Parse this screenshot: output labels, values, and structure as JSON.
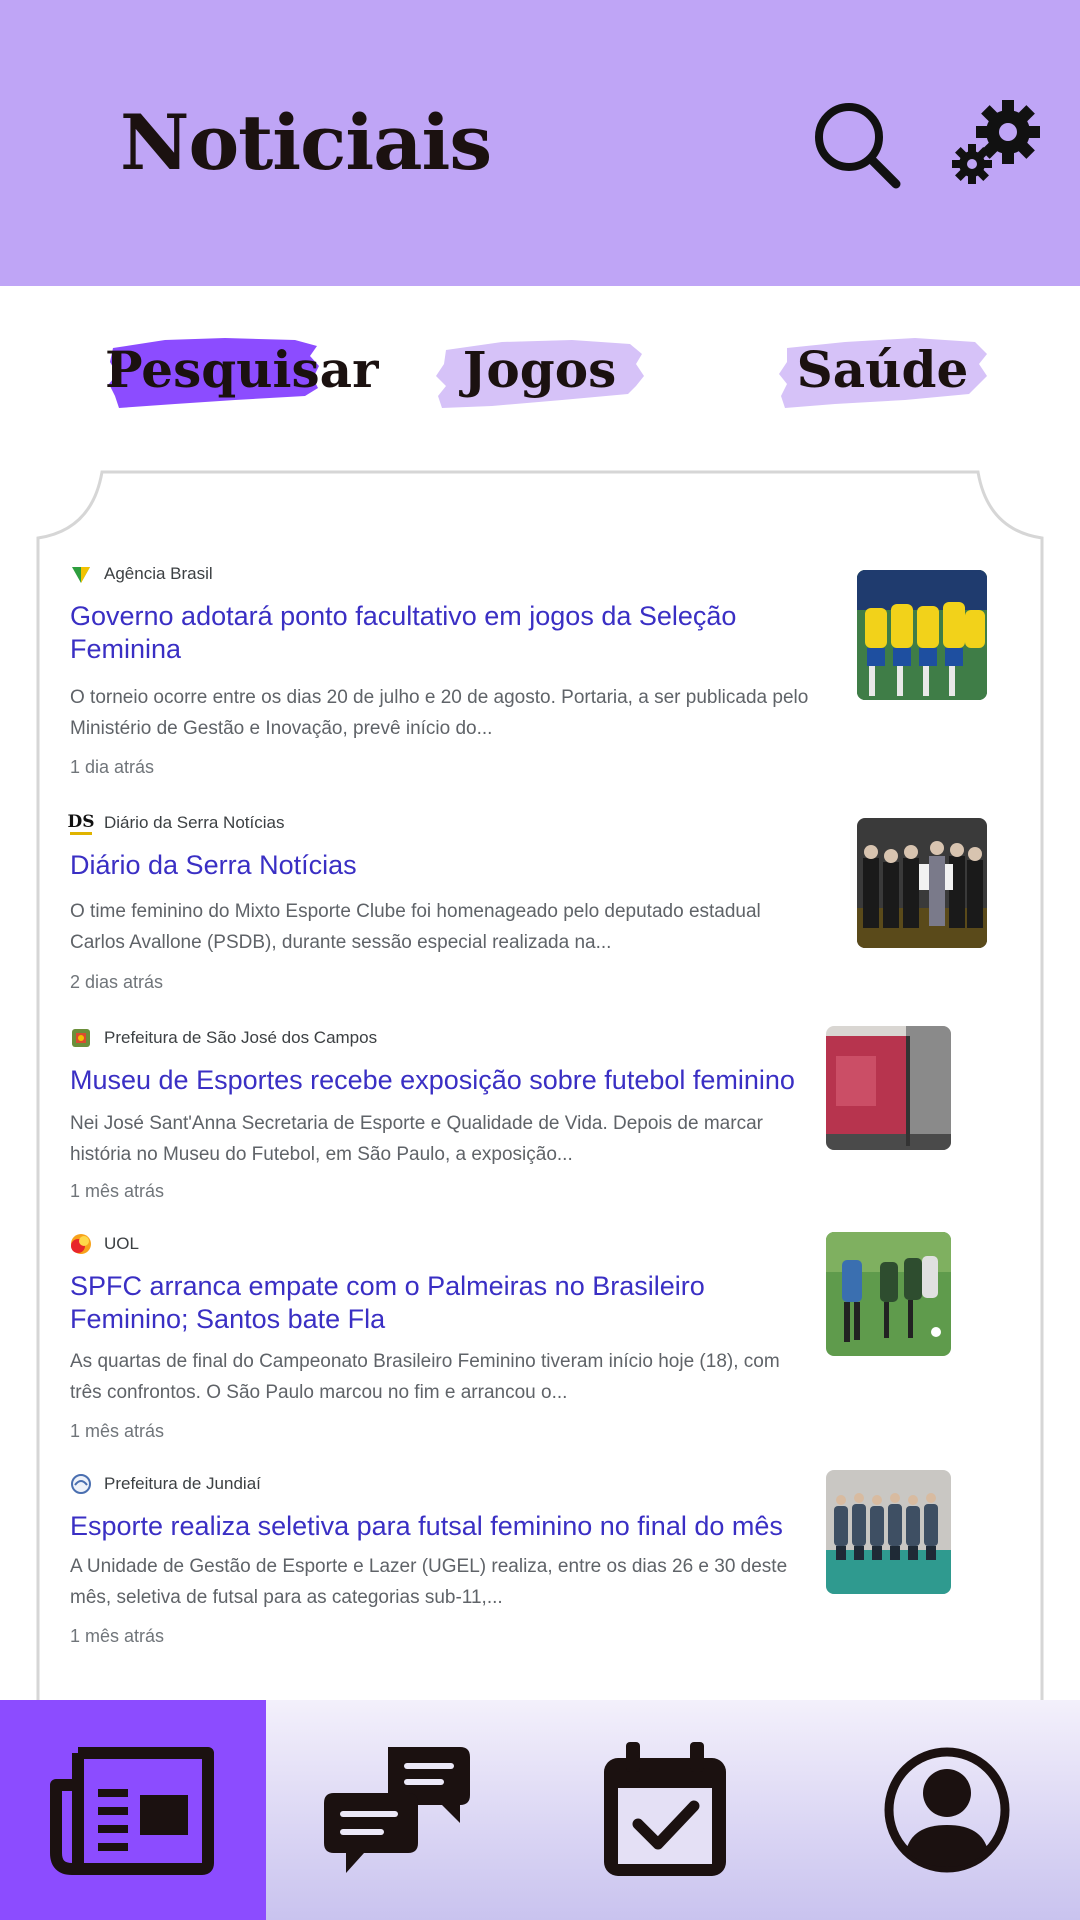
{
  "app": {
    "title": "Noticiais"
  },
  "header": {
    "search_icon": "search-icon",
    "settings_icon": "gears-icon"
  },
  "tabs": [
    {
      "label": "Pesquisar",
      "active": true,
      "color": "#8c4cff"
    },
    {
      "label": "Jogos",
      "active": false,
      "color": "#d6c2f8"
    },
    {
      "label": "Saúde",
      "active": false,
      "color": "#d6c2f8"
    }
  ],
  "news": [
    {
      "source": "Agência Brasil",
      "headline_line1": "Governo adotará ponto facultativo em jogos da Seleção",
      "headline_line2": "Feminina",
      "snippet_line1": "O torneio ocorre entre os dias 20 de julho e 20 de agosto. Portaria, a ser publicada pelo",
      "snippet_line2": "Ministério de Gestão e Inovação, prevê início do...",
      "time": "1 dia atrás"
    },
    {
      "source": "Diário da Serra Notícias",
      "headline_line1": "Diário da Serra Notícias",
      "snippet_line1": "O time feminino do Mixto Esporte Clube foi homenageado pelo deputado estadual",
      "snippet_line2": "Carlos Avallone (PSDB), durante sessão especial realizada na...",
      "time": "2 dias atrás"
    },
    {
      "source": "Prefeitura de São José dos Campos",
      "headline_line1": "Museu de Esportes recebe exposição sobre futebol feminino",
      "snippet_line1": "Nei José Sant'Anna Secretaria de Esporte e Qualidade de Vida. Depois de marcar",
      "snippet_line2": "história no Museu do Futebol, em São Paulo, a exposição...",
      "time": "1 mês atrás"
    },
    {
      "source": "UOL",
      "headline_line1": "SPFC arranca empate com o Palmeiras no Brasileiro",
      "headline_line2": "Feminino; Santos bate Fla",
      "snippet_line1": "As quartas de final do Campeonato Brasileiro Feminino tiveram início hoje (18), com",
      "snippet_line2": "três confrontos. O São Paulo marcou no fim e arrancou o...",
      "time": "1 mês atrás"
    },
    {
      "source": "Prefeitura de Jundiaí",
      "headline_line1": "Esporte realiza seletiva para futsal feminino no final do mês",
      "snippet_line1": "A Unidade de Gestão de Esporte e Lazer (UGEL) realiza, entre os dias 26 e 30 deste",
      "snippet_line2": "mês, seletiva de futsal para as categorias sub-11,...",
      "time": "1 mês atrás"
    }
  ],
  "source_logo_text": {
    "ds": "DS"
  },
  "nav": [
    {
      "icon": "newspaper-icon",
      "active": true
    },
    {
      "icon": "chat-icon",
      "active": false
    },
    {
      "icon": "calendar-check-icon",
      "active": false
    },
    {
      "icon": "profile-icon",
      "active": false
    }
  ],
  "colors": {
    "header": "#bfa5f6",
    "accent": "#8c4cff",
    "headline": "#3a2fc4",
    "tab_inactive": "#d6c2f8"
  }
}
